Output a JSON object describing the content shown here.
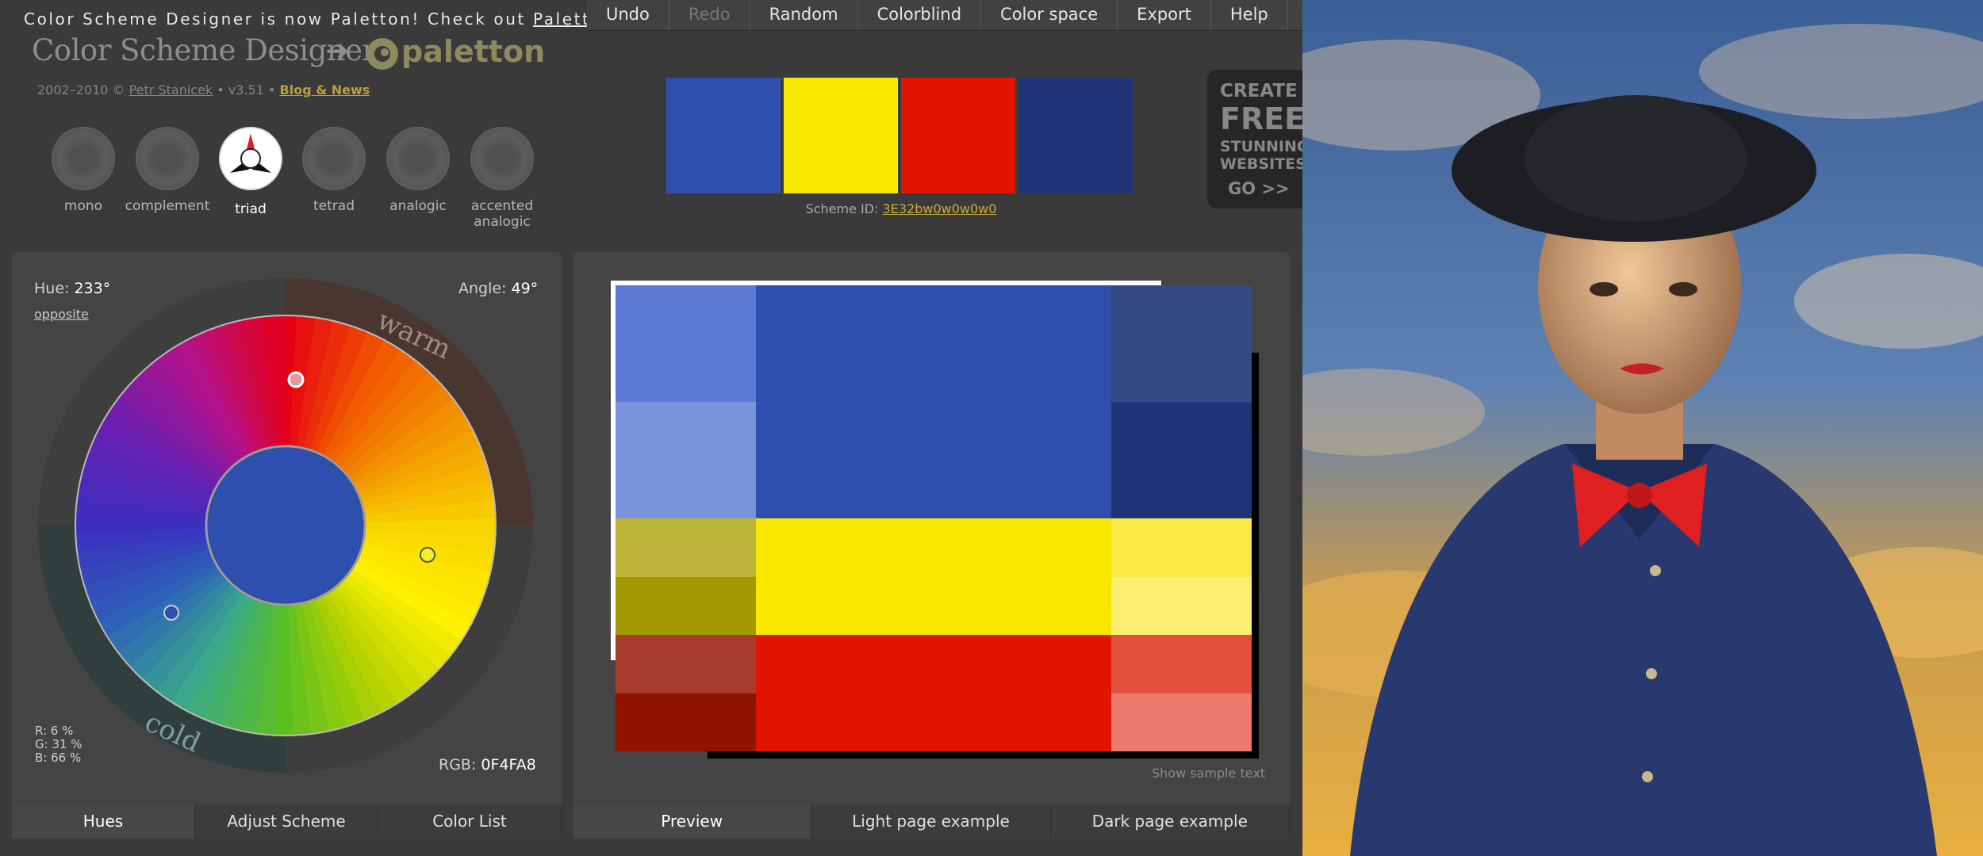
{
  "notice": {
    "text": "Color Scheme Designer is now Paletton! Check out ",
    "link": "Paletton.com"
  },
  "menu": [
    {
      "label": "Undo",
      "enabled": true
    },
    {
      "label": "Redo",
      "enabled": false
    },
    {
      "label": "Random",
      "enabled": true
    },
    {
      "label": "Colorblind",
      "enabled": true
    },
    {
      "label": "Color space",
      "enabled": true
    },
    {
      "label": "Export",
      "enabled": true
    },
    {
      "label": "Help",
      "enabled": true
    }
  ],
  "logo": {
    "title": "Color Scheme Designer",
    "arrow": "➜",
    "brand": "paletton"
  },
  "credits": {
    "years": "2002–2010 © ",
    "author": "Petr Stanicek",
    "version": " • v3.51 • ",
    "blog": "Blog & News"
  },
  "schemes": [
    {
      "label": "mono",
      "active": false
    },
    {
      "label": "complement",
      "active": false
    },
    {
      "label": "triad",
      "active": true
    },
    {
      "label": "tetrad",
      "active": false
    },
    {
      "label": "analogic",
      "active": false
    },
    {
      "label": "accented\nanalogic",
      "active": false
    }
  ],
  "swatches": [
    "#2F4FAE",
    "#F8E800",
    "#E01400",
    "#1F3577"
  ],
  "scheme_id": {
    "label": "Scheme ID: ",
    "value": "3E32bw0w0w0w0"
  },
  "ad": {
    "line1": "CREATE",
    "line2": "FREE",
    "line3": "STUNNING",
    "line4": "WEBSITES",
    "line5": "GO >>"
  },
  "hues": {
    "hue_label": "Hue:",
    "hue_value": "233°",
    "angle_label": "Angle:",
    "angle_value": "49°",
    "opposite": "opposite",
    "warm": "warm",
    "cold": "cold",
    "r": "R:   6 %",
    "g": "G: 31 %",
    "b": "B: 66 %",
    "rgb_label": "RGB:",
    "rgb_value": "0F4FA8",
    "center_color": "#2F4FAE"
  },
  "tabs_left": [
    {
      "label": "Hues",
      "active": true
    },
    {
      "label": "Adjust Scheme",
      "active": false
    },
    {
      "label": "Color List",
      "active": false
    }
  ],
  "tabs_right": [
    {
      "label": "Preview",
      "active": true
    },
    {
      "label": "Light page example",
      "active": false
    },
    {
      "label": "Dark page example",
      "active": false
    }
  ],
  "show_sample": "Show sample text",
  "preview": {
    "rows": [
      [
        "#5A7AD6",
        "#2F4FAE",
        "#344A85"
      ],
      [
        "#7993DA",
        "#2F4FAE",
        "#1F3577"
      ],
      [
        "#BCB33A",
        "#F8E800",
        "#FBE945"
      ],
      [
        "#A29800",
        "#F8E800",
        "#FDEE6F"
      ],
      [
        "#A93B2C",
        "#E01400",
        "#E5503E"
      ],
      [
        "#921300",
        "#E01400",
        "#EC7B6E"
      ]
    ]
  }
}
